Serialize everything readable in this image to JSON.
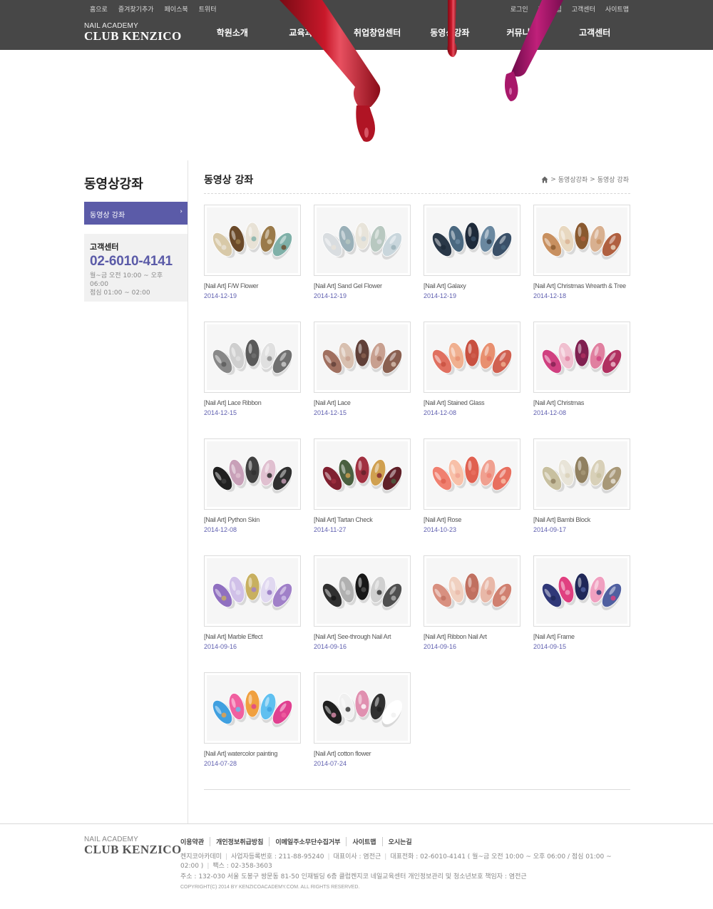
{
  "header": {
    "util_left": [
      "홈으로",
      "즐겨찾기추가",
      "페이스북",
      "트위터"
    ],
    "util_right": [
      "로그인",
      "회원가입",
      "고객센터",
      "사이트맵"
    ],
    "logo_small": "NAIL ACADEMY",
    "logo_big": "CLUB KENZICO",
    "gnb": [
      "학원소개",
      "교육과정",
      "취업창업센터",
      "동영상강좌",
      "커뮤니티",
      "고객센터"
    ]
  },
  "sidebar": {
    "title": "동영상강좌",
    "menu_item": "동영상 강좌",
    "menu_arrow": "›",
    "cs_title": "고객센터",
    "cs_phone": "02-6010-4141",
    "cs_hours": "월~금 오전 10:00 ~ 오후 06:00",
    "cs_lunch": "점심 01:00 ~ 02:00"
  },
  "content": {
    "title": "동영상 강좌",
    "breadcrumb": [
      "동영상강좌",
      "동영상 강좌"
    ],
    "breadcrumb_sep": ">"
  },
  "videos": [
    {
      "title": "[Nail Art] F/W Flower",
      "date": "2014-12-19",
      "colors": [
        "#d8c9a8",
        "#6b4a2a",
        "#e8e2d6",
        "#9a7a4a",
        "#7fb0a8"
      ]
    },
    {
      "title": "[Nail Art] Sand Gel Flower",
      "date": "2014-12-19",
      "colors": [
        "#d9dde0",
        "#9ab0b8",
        "#e8e4da",
        "#b8c8c0",
        "#c9d6dc"
      ]
    },
    {
      "title": "[Nail Art] Galaxy",
      "date": "2014-12-19",
      "colors": [
        "#2a3848",
        "#4a6880",
        "#1e2a3a",
        "#6a88a0",
        "#3a5068"
      ]
    },
    {
      "title": "[Nail Art] Christmas Wrearth & Tree",
      "date": "2014-12-18",
      "colors": [
        "#c89060",
        "#e8d8c0",
        "#8a5a30",
        "#d8b090",
        "#b06040"
      ]
    },
    {
      "title": "[Nail Art] Lace Ribbon",
      "date": "2014-12-15",
      "colors": [
        "#888888",
        "#cfcfcf",
        "#5a5a5a",
        "#e0e0e0",
        "#707070"
      ]
    },
    {
      "title": "[Nail Art] Lace",
      "date": "2014-12-15",
      "colors": [
        "#a07060",
        "#d8c0b0",
        "#604038",
        "#c8a090",
        "#8a6050"
      ]
    },
    {
      "title": "[Nail Art] Stained Glass",
      "date": "2014-12-08",
      "colors": [
        "#e07060",
        "#f0b090",
        "#c85040",
        "#e89070",
        "#d06050"
      ]
    },
    {
      "title": "[Nail Art] Christmas",
      "date": "2014-12-08",
      "colors": [
        "#d04080",
        "#f0c0d0",
        "#802050",
        "#e080a0",
        "#b03060"
      ]
    },
    {
      "title": "[Nail Art] Python Skin",
      "date": "2014-12-08",
      "colors": [
        "#202020",
        "#c8a0b8",
        "#404040",
        "#e0c0d0",
        "#303030"
      ]
    },
    {
      "title": "[Nail Art] Tartan Check",
      "date": "2014-11-27",
      "colors": [
        "#802030",
        "#4a6040",
        "#a03040",
        "#d0a050",
        "#602028"
      ]
    },
    {
      "title": "[Nail Art] Rose",
      "date": "2014-10-23",
      "colors": [
        "#f08070",
        "#f8c0a8",
        "#e06050",
        "#f0a090",
        "#e87060"
      ]
    },
    {
      "title": "[Nail Art] Bambi Block",
      "date": "2014-09-17",
      "colors": [
        "#c8c0a0",
        "#e8e4d8",
        "#908060",
        "#d8d0b8",
        "#a89878"
      ]
    },
    {
      "title": "[Nail Art] Marble Effect",
      "date": "2014-09-16",
      "colors": [
        "#9070c0",
        "#d0c0e8",
        "#c8b060",
        "#e0d8f0",
        "#a080c8"
      ]
    },
    {
      "title": "[Nail Art] See-through Nail Art",
      "date": "2014-09-16",
      "colors": [
        "#303030",
        "#b0b0b0",
        "#181818",
        "#d0d0d0",
        "#505050"
      ]
    },
    {
      "title": "[Nail Art] Ribbon Nail Art",
      "date": "2014-09-16",
      "colors": [
        "#d89080",
        "#f0d0c0",
        "#c07060",
        "#e8b8a8",
        "#d08070"
      ]
    },
    {
      "title": "[Nail Art] Frame",
      "date": "2014-09-15",
      "colors": [
        "#303878",
        "#e04080",
        "#202858",
        "#f0a0c0",
        "#5060a0"
      ]
    },
    {
      "title": "[Nail Art] watercolor painting",
      "date": "2014-07-28",
      "colors": [
        "#40a0e0",
        "#f060a0",
        "#f0a040",
        "#60c0f0",
        "#e04090"
      ]
    },
    {
      "title": "[Nail Art] cotton flower",
      "date": "2014-07-24",
      "colors": [
        "#202020",
        "#f0f0f0",
        "#e090b0",
        "#303030",
        "#ffffff"
      ]
    }
  ],
  "footer": {
    "logo_small": "NAIL ACADEMY",
    "logo_big": "CLUB KENZICO",
    "links": [
      "이용약관",
      "개인정보취급방침",
      "이메일주소무단수집거부",
      "사이트맵",
      "오시는길"
    ],
    "company": "켄지코아카데미",
    "biz_no": "사업자등록번호 : 211-88-95240",
    "ceo": "대표이사 : 염전근",
    "tel": "대표전화 : 02-6010-4141 ( 월~금 오전 10:00 ~ 오후 06:00 / 점심 01:00 ~ 02:00 )",
    "fax": "팩스 : 02-358-3603",
    "address": "주소 : 132-030 서울 도봉구 쌍문동 81-50 인재빌딩 6층 클럽켄지코 네일교육센터 개인정보관리 및 청소년보호 책임자 : 염전근",
    "copyright": "COPYRIGHT(C) 2014 BY KENZICOACADEMY.COM. ALL RIGHTS RESERVED."
  },
  "accent_color": "#5b5ba8",
  "icons": [
    "home-icon",
    "chevron-right-icon"
  ]
}
